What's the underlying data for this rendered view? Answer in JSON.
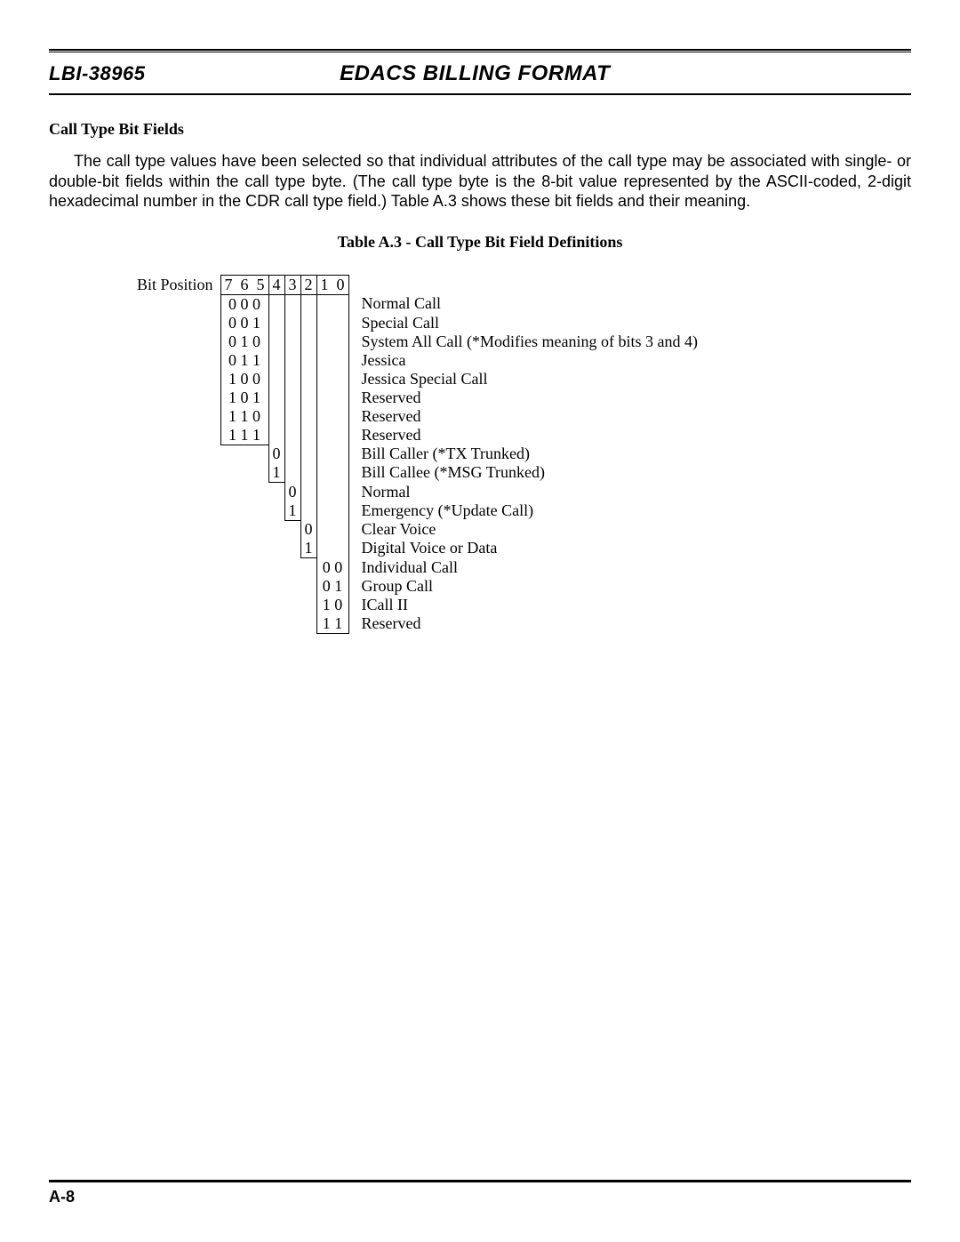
{
  "header": {
    "doc_id": "LBI-38965",
    "title": "EDACS BILLING FORMAT"
  },
  "section": {
    "heading": "Call Type Bit Fields",
    "paragraph": "The call type values have been selected so that individual attributes of the call type may be associated with single- or double-bit fields within the call type byte. (The call type byte is the 8-bit value represented by the ASCII-coded, 2-digit hexadecimal number in the CDR call type field.)  Table A.3 shows these bit fields and their meaning."
  },
  "table": {
    "caption": "Table A.3 - Call Type Bit Field Definitions",
    "bit_position_label": "Bit Position",
    "header_bits": [
      "7",
      "6",
      "5",
      "4",
      "3",
      "2",
      "1",
      "0"
    ],
    "rows": [
      {
        "b765": "0  0   0",
        "b4": "",
        "b3": "",
        "b2": "",
        "b10": "",
        "label": "Normal Call"
      },
      {
        "b765": "0  0   1",
        "b4": "",
        "b3": "",
        "b2": "",
        "b10": "",
        "label": "Special Call"
      },
      {
        "b765": "0  1   0",
        "b4": "",
        "b3": "",
        "b2": "",
        "b10": "",
        "label": "System All Call (*Modifies meaning of bits 3 and 4)"
      },
      {
        "b765": "0  1   1",
        "b4": "",
        "b3": "",
        "b2": "",
        "b10": "",
        "label": "Jessica"
      },
      {
        "b765": "1  0   0",
        "b4": "",
        "b3": "",
        "b2": "",
        "b10": "",
        "label": "Jessica Special Call"
      },
      {
        "b765": "1  0   1",
        "b4": "",
        "b3": "",
        "b2": "",
        "b10": "",
        "label": "Reserved"
      },
      {
        "b765": "1  1   0",
        "b4": "",
        "b3": "",
        "b2": "",
        "b10": "",
        "label": "Reserved"
      },
      {
        "b765": "1  1   1",
        "b4": "",
        "b3": "",
        "b2": "",
        "b10": "",
        "label": "Reserved"
      },
      {
        "b765": "",
        "b4": "0",
        "b3": "",
        "b2": "",
        "b10": "",
        "label": "Bill Caller (*TX Trunked)"
      },
      {
        "b765": "",
        "b4": "1",
        "b3": "",
        "b2": "",
        "b10": "",
        "label": "Bill Callee (*MSG Trunked)"
      },
      {
        "b765": "",
        "b4": "",
        "b3": "0",
        "b2": "",
        "b10": "",
        "label": "Normal"
      },
      {
        "b765": "",
        "b4": "",
        "b3": "1",
        "b2": "",
        "b10": "",
        "label": "Emergency (*Update Call)"
      },
      {
        "b765": "",
        "b4": "",
        "b3": "",
        "b2": "0",
        "b10": "",
        "label": "Clear Voice"
      },
      {
        "b765": "",
        "b4": "",
        "b3": "",
        "b2": "1",
        "b10": "",
        "label": "Digital Voice or Data"
      },
      {
        "b765": "",
        "b4": "",
        "b3": "",
        "b2": "",
        "b10": "0 0",
        "label": "Individual Call"
      },
      {
        "b765": "",
        "b4": "",
        "b3": "",
        "b2": "",
        "b10": "0 1",
        "label": "Group Call"
      },
      {
        "b765": "",
        "b4": "",
        "b3": "",
        "b2": "",
        "b10": "1 0",
        "label": "ICall II"
      },
      {
        "b765": "",
        "b4": "",
        "b3": "",
        "b2": "",
        "b10": "1 1",
        "label": "Reserved"
      }
    ]
  },
  "footer": {
    "page": "A-8"
  }
}
